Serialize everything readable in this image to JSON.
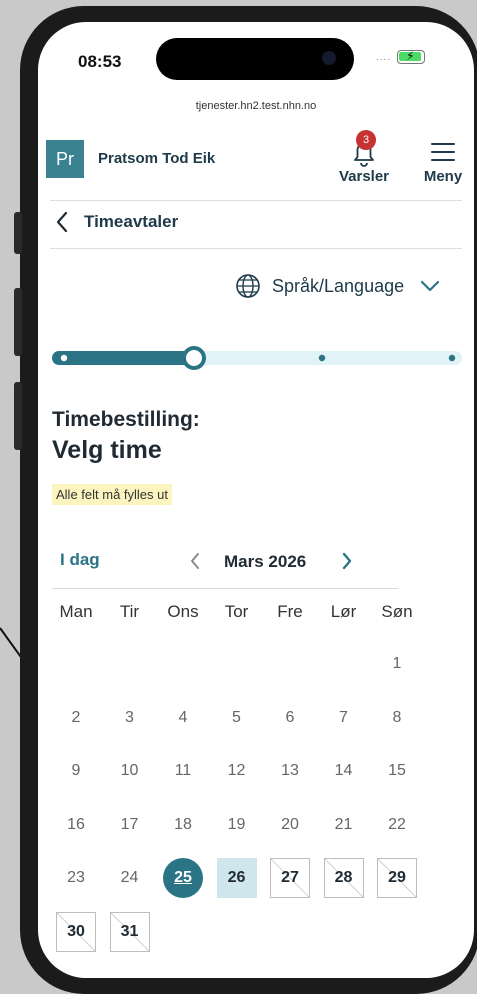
{
  "status_bar": {
    "time": "08:53",
    "signal_dots": "....",
    "battery_charging": true
  },
  "browser": {
    "url": "tjenester.hn2.test.nhn.no"
  },
  "header": {
    "logo_text": "Pr",
    "org_name": "Pratsom Tod Eik",
    "notifications": {
      "count": "3",
      "label": "Varsler"
    },
    "menu_label": "Meny"
  },
  "nav": {
    "back_label": "Timeavtaler"
  },
  "language": {
    "label": "Språk/Language"
  },
  "progress": {
    "current_step": 2,
    "total_steps": 4
  },
  "form": {
    "title_line1": "Timebestilling:",
    "title_line2": "Velg time",
    "required_note": "Alle felt må fylles ut"
  },
  "calendar": {
    "today_label": "I dag",
    "month_label": "Mars 2026",
    "weekdays": [
      "Man",
      "Tir",
      "Ons",
      "Tor",
      "Fre",
      "Lør",
      "Søn"
    ],
    "days": [
      {
        "n": "1",
        "state": "disabled"
      },
      {
        "n": "2",
        "state": "disabled"
      },
      {
        "n": "3",
        "state": "disabled"
      },
      {
        "n": "4",
        "state": "disabled"
      },
      {
        "n": "5",
        "state": "disabled"
      },
      {
        "n": "6",
        "state": "disabled"
      },
      {
        "n": "7",
        "state": "disabled"
      },
      {
        "n": "8",
        "state": "disabled"
      },
      {
        "n": "9",
        "state": "disabled"
      },
      {
        "n": "10",
        "state": "disabled"
      },
      {
        "n": "11",
        "state": "disabled"
      },
      {
        "n": "12",
        "state": "disabled"
      },
      {
        "n": "13",
        "state": "disabled"
      },
      {
        "n": "14",
        "state": "disabled"
      },
      {
        "n": "15",
        "state": "disabled"
      },
      {
        "n": "16",
        "state": "disabled"
      },
      {
        "n": "17",
        "state": "disabled"
      },
      {
        "n": "18",
        "state": "disabled"
      },
      {
        "n": "19",
        "state": "disabled"
      },
      {
        "n": "20",
        "state": "disabled"
      },
      {
        "n": "21",
        "state": "disabled"
      },
      {
        "n": "22",
        "state": "disabled"
      },
      {
        "n": "23",
        "state": "disabled"
      },
      {
        "n": "24",
        "state": "disabled"
      },
      {
        "n": "25",
        "state": "selected"
      },
      {
        "n": "26",
        "state": "available"
      },
      {
        "n": "27",
        "state": "unavailable"
      },
      {
        "n": "28",
        "state": "unavailable"
      },
      {
        "n": "29",
        "state": "unavailable"
      },
      {
        "n": "30",
        "state": "unavailable"
      },
      {
        "n": "31",
        "state": "unavailable"
      }
    ]
  },
  "colors": {
    "primary": "#2b7486",
    "badge": "#c73232",
    "highlight": "#cfe7ec",
    "note_bg": "#fbf4bf"
  }
}
